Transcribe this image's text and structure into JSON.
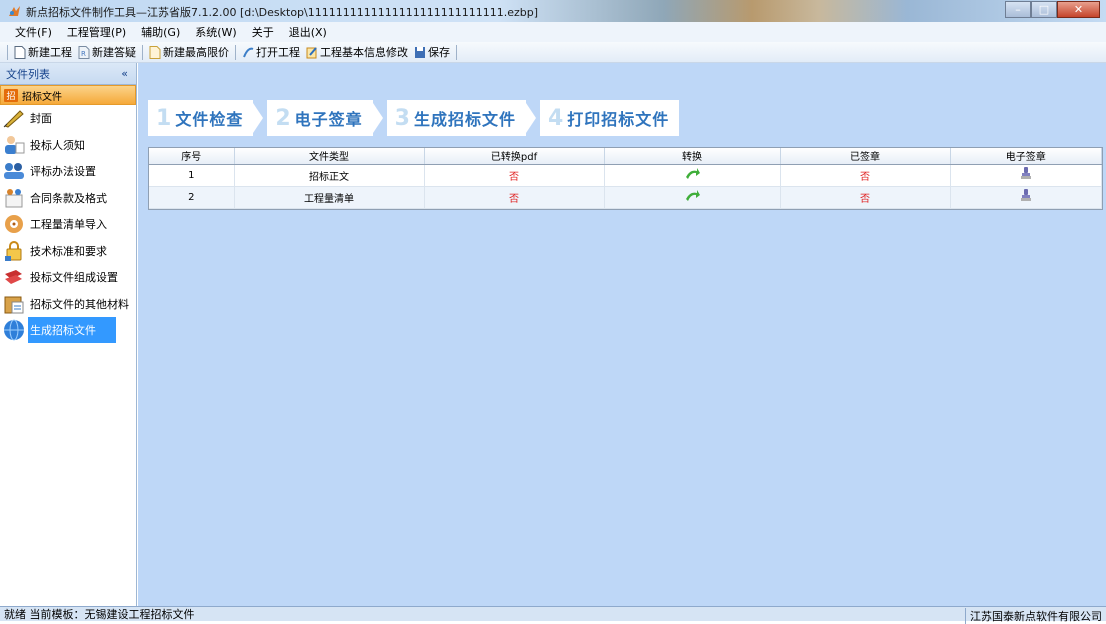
{
  "window": {
    "title": "新点招标文件制作工具—江苏省版7.1.2.00   [d:\\Desktop\\1111111111111111111111111111.ezbp]",
    "minimize_glyph": "–",
    "maximize_glyph": "□",
    "close_glyph": "✕"
  },
  "menu": [
    "文件(F)",
    "工程管理(P)",
    "辅助(G)",
    "系统(W)",
    "关于",
    "退出(X)"
  ],
  "toolbar": {
    "new_project": "新建工程",
    "new_answer": "新建答疑",
    "new_max_price": "新建最高限价",
    "open_project": "打开工程",
    "edit_info": "工程基本信息修改",
    "save": "保存"
  },
  "sidebar": {
    "header": "文件列表",
    "collapse_glyph": "«",
    "active_group_tag": "招",
    "active_group": "招标文件",
    "items": [
      {
        "label": "封面",
        "icon": "pen-icon"
      },
      {
        "label": "投标人须知",
        "icon": "person-icon"
      },
      {
        "label": "评标办法设置",
        "icon": "people-icon"
      },
      {
        "label": "合同条款及格式",
        "icon": "contract-icon"
      },
      {
        "label": "工程量清单导入",
        "icon": "disc-icon"
      },
      {
        "label": "技术标准和要求",
        "icon": "lock-icon"
      },
      {
        "label": "投标文件组成设置",
        "icon": "files-icon"
      },
      {
        "label": "招标文件的其他材料",
        "icon": "folder-icon"
      },
      {
        "label": "生成招标文件",
        "icon": "globe-icon"
      }
    ]
  },
  "steps": [
    {
      "num": "1",
      "label": "文件检查"
    },
    {
      "num": "2",
      "label": "电子签章"
    },
    {
      "num": "3",
      "label": "生成招标文件"
    },
    {
      "num": "4",
      "label": "打印招标文件"
    }
  ],
  "table": {
    "columns": [
      "序号",
      "文件类型",
      "已转换pdf",
      "转换",
      "已签章",
      "电子签章"
    ],
    "rows": [
      {
        "seq": "1",
        "type": "招标正文",
        "converted": "否",
        "signed": "否"
      },
      {
        "seq": "2",
        "type": "工程量清单",
        "converted": "否",
        "signed": "否"
      }
    ]
  },
  "status": {
    "left": "就绪   当前模板：无锡建设工程招标文件",
    "right": "江苏国泰新点软件有限公司"
  }
}
